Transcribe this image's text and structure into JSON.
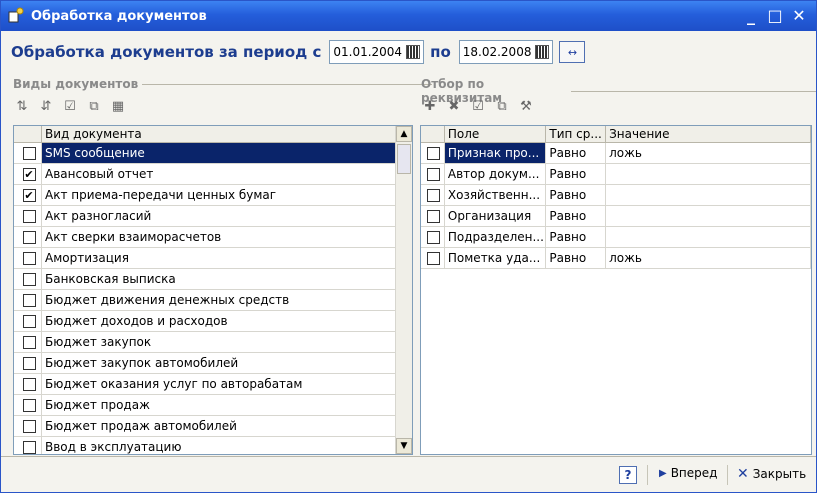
{
  "window": {
    "title": "Обработка документов"
  },
  "period": {
    "label": "Обработка документов за период с",
    "from": "01.01.2004",
    "to_label": "по",
    "to": "18.02.2008",
    "range_button": "↔"
  },
  "doc_types": {
    "label": "Виды документов",
    "column": "Вид документа",
    "items": [
      {
        "name": "SMS сообщение",
        "checked": false,
        "selected": true
      },
      {
        "name": "Авансовый отчет",
        "checked": true
      },
      {
        "name": "Акт приема-передачи ценных бумаг",
        "checked": true
      },
      {
        "name": "Акт разногласий",
        "checked": false
      },
      {
        "name": "Акт сверки взаиморасчетов",
        "checked": false
      },
      {
        "name": "Амортизация",
        "checked": false
      },
      {
        "name": "Банковская выписка",
        "checked": false
      },
      {
        "name": "Бюджет движения денежных средств",
        "checked": false
      },
      {
        "name": "Бюджет доходов и расходов",
        "checked": false
      },
      {
        "name": "Бюджет закупок",
        "checked": false
      },
      {
        "name": "Бюджет закупок автомобилей",
        "checked": false
      },
      {
        "name": "Бюджет оказания услуг по авторабатам",
        "checked": false
      },
      {
        "name": "Бюджет продаж",
        "checked": false
      },
      {
        "name": "Бюджет продаж автомобилей",
        "checked": false
      },
      {
        "name": "Ввод в эксплуатацию",
        "checked": false
      }
    ]
  },
  "filter": {
    "label": "Отбор по реквизитам",
    "columns": [
      "Поле",
      "Тип ср...",
      "Значение"
    ],
    "rows": [
      {
        "field": "Признак про...",
        "type": "Равно",
        "value": "ложь",
        "selected": true
      },
      {
        "field": "Автор докум...",
        "type": "Равно",
        "value": ""
      },
      {
        "field": "Хозяйственн...",
        "type": "Равно",
        "value": ""
      },
      {
        "field": "Организация",
        "type": "Равно",
        "value": ""
      },
      {
        "field": "Подразделен...",
        "type": "Равно",
        "value": ""
      },
      {
        "field": "Пометка уда...",
        "type": "Равно",
        "value": "ложь"
      }
    ]
  },
  "footer": {
    "help": "?",
    "next": "Вперед",
    "close": "Закрыть"
  }
}
